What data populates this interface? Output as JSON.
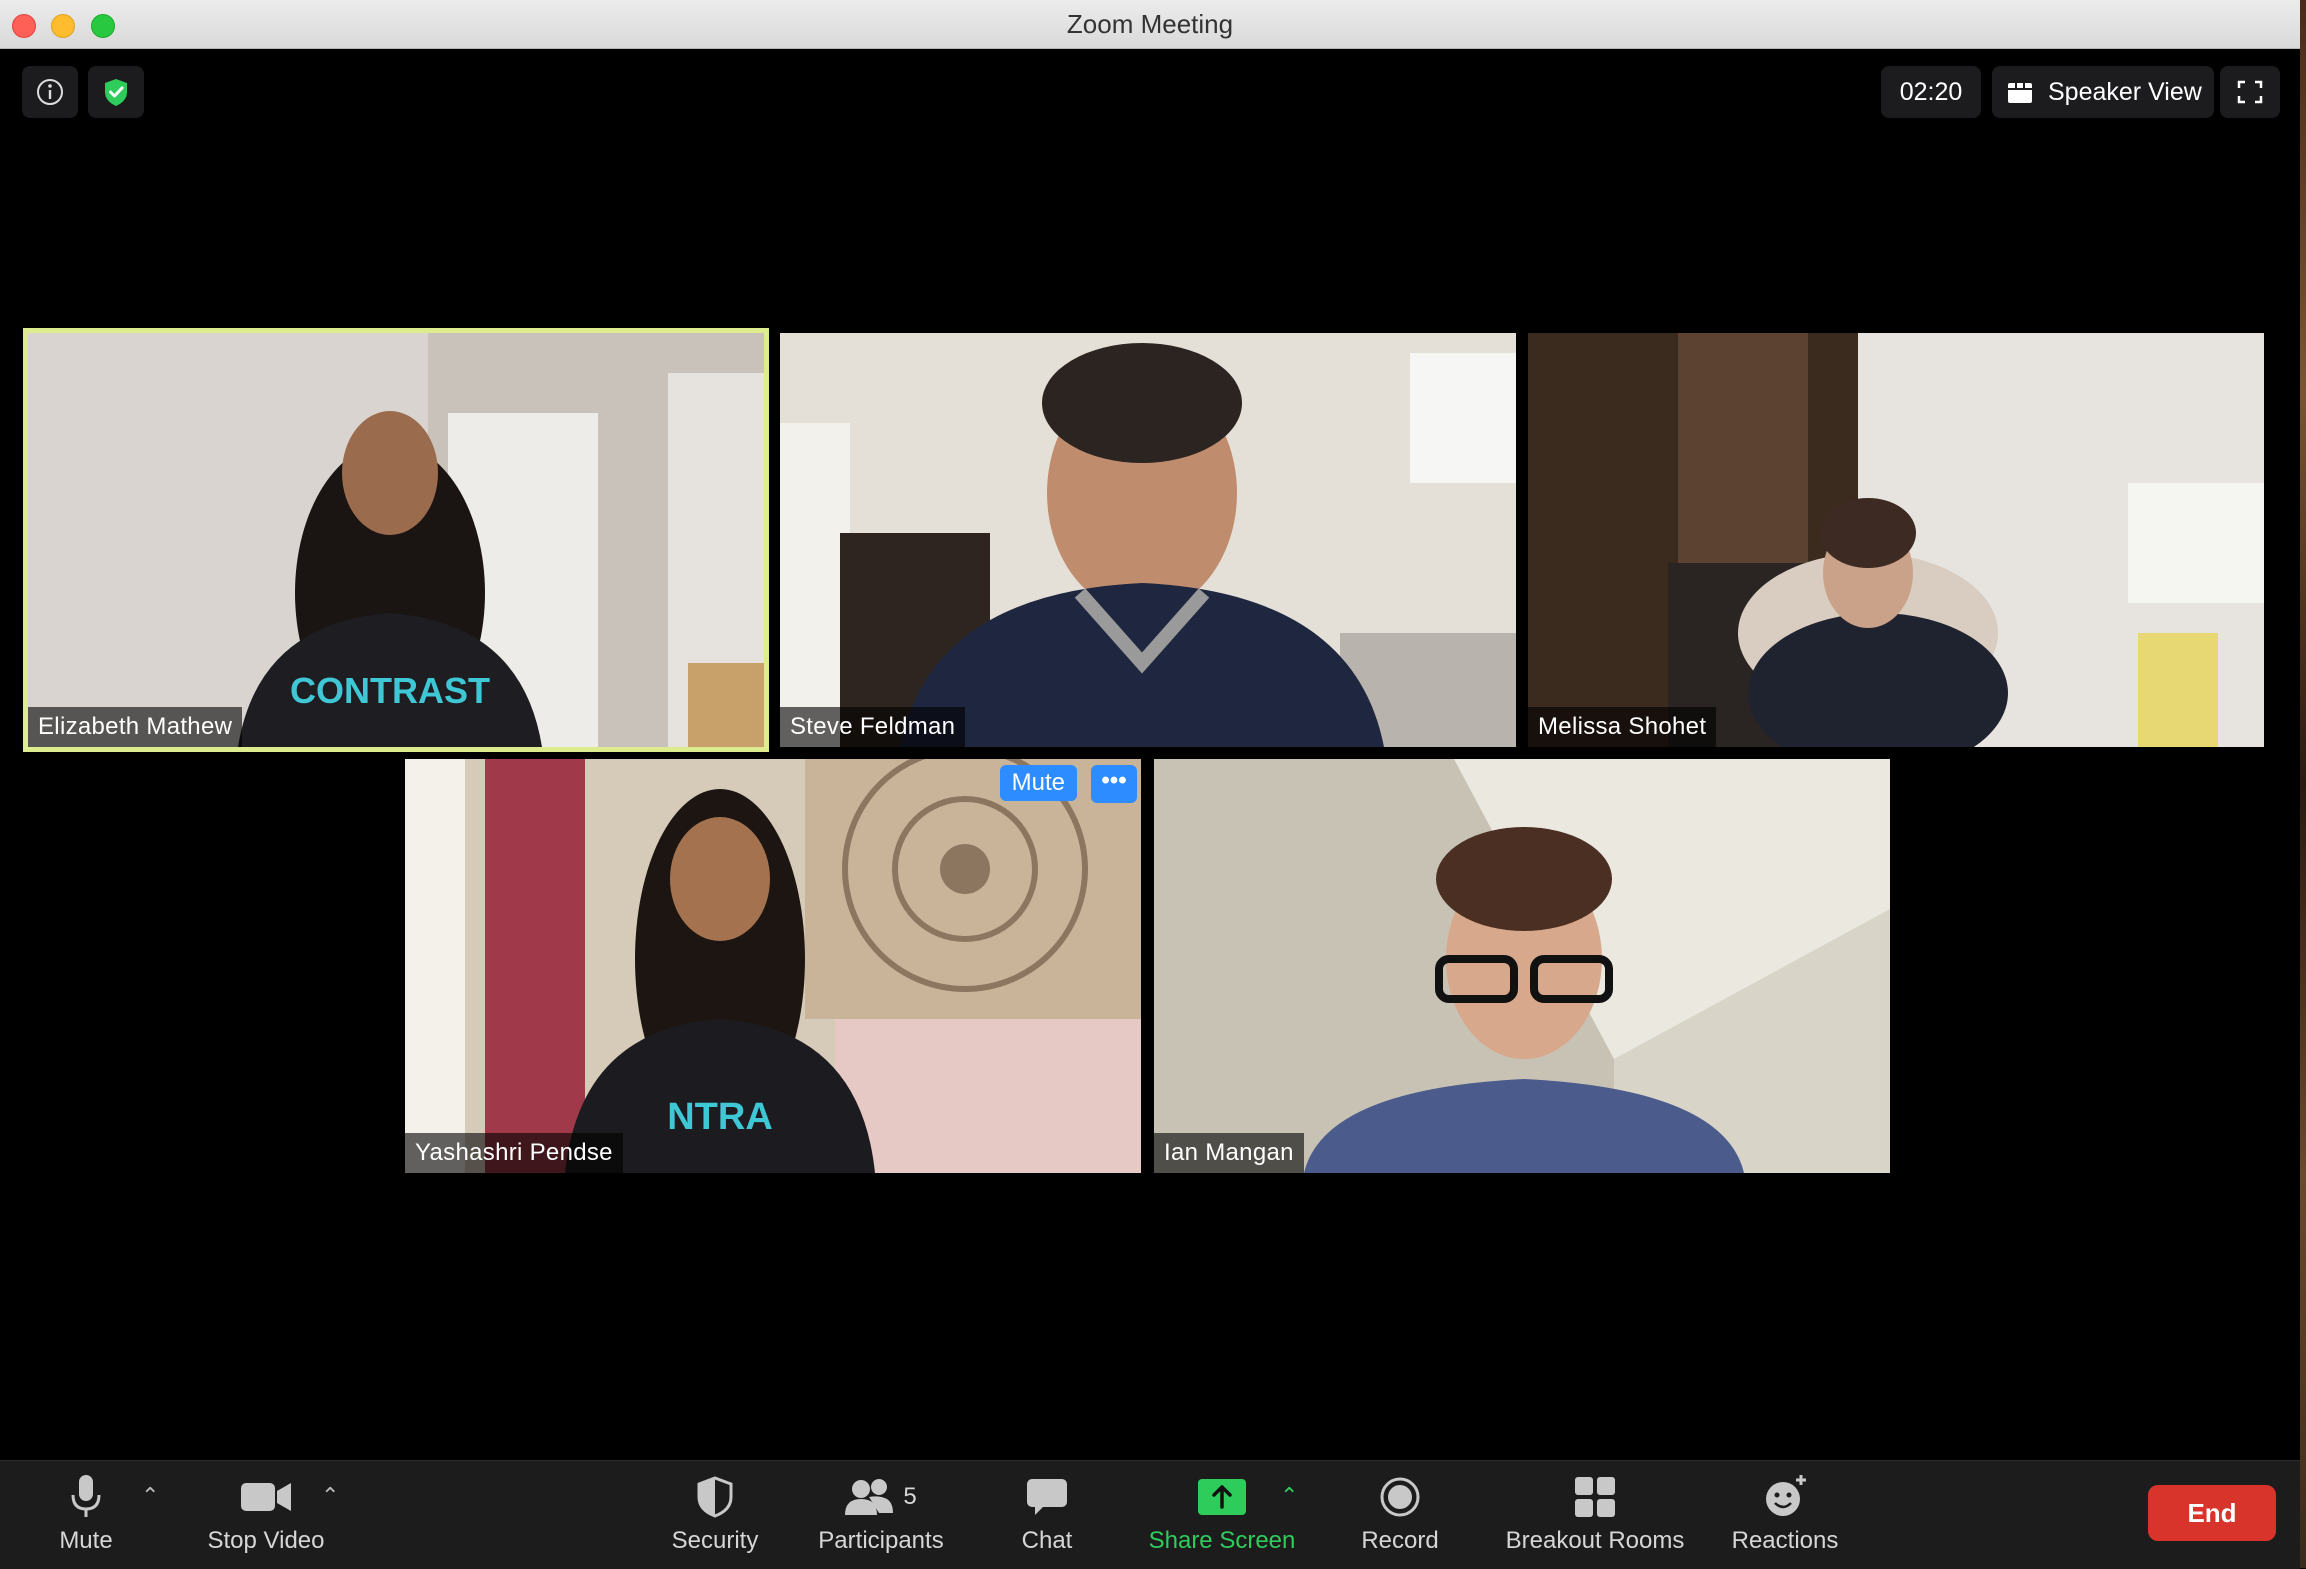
{
  "window": {
    "title": "Zoom Meeting"
  },
  "topbar": {
    "timer": "02:20",
    "view_label": "Speaker View",
    "security_color": "#2ecc5b"
  },
  "participants": [
    {
      "name": "Elizabeth Mathew",
      "active_speaker": true
    },
    {
      "name": "Steve Feldman",
      "active_speaker": false
    },
    {
      "name": "Melissa Shohet",
      "active_speaker": false
    },
    {
      "name": "Yashashri Pendse",
      "active_speaker": false,
      "hover_mute": "Mute",
      "hover_more": "•••"
    },
    {
      "name": "Ian Mangan",
      "active_speaker": false
    }
  ],
  "toolbar": {
    "mute": "Mute",
    "stop_video": "Stop Video",
    "security": "Security",
    "participants": "Participants",
    "participants_count": "5",
    "chat": "Chat",
    "share_screen": "Share Screen",
    "record": "Record",
    "breakout_rooms": "Breakout Rooms",
    "reactions": "Reactions",
    "end": "End",
    "share_color": "#2ecc5b",
    "end_color": "#d9342b"
  }
}
